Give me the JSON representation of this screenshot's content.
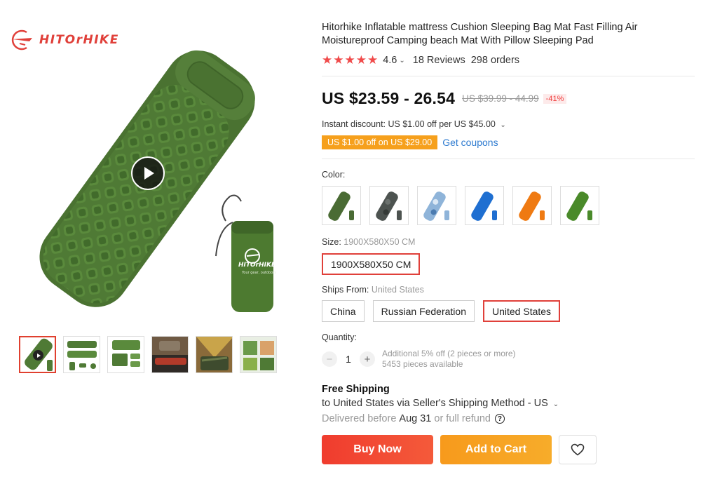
{
  "brand": {
    "name": "HITOrHIKE",
    "color": "#e0403a"
  },
  "gallery": {
    "main_image": "green-inflatable-sleeping-pad-with-pillow-and-stuff-sack",
    "bag_logo": "HITOrHIKE",
    "bag_tagline": "Your gear, outdoors",
    "play_icon": "play-icon",
    "thumbnails": [
      {
        "name": "thumb-video-green-pad",
        "active": true
      },
      {
        "name": "thumb-green-pad-accessories",
        "active": false
      },
      {
        "name": "thumb-green-pad-package",
        "active": false
      },
      {
        "name": "thumb-pad-in-car-trunk",
        "active": false
      },
      {
        "name": "thumb-pad-in-tent",
        "active": false
      },
      {
        "name": "thumb-pad-outdoor-use",
        "active": false
      }
    ]
  },
  "product": {
    "title": "Hitorhike Inflatable mattress Cushion Sleeping Bag Mat Fast Filling Air Moistureproof Camping beach Mat With Pillow Sleeping Pad",
    "rating": "4.6",
    "stars": "★★★★★",
    "reviews": "18 Reviews",
    "orders": "298 orders",
    "price": "US $23.59 - 26.54",
    "original_price": "US $39.99 - 44.99",
    "discount": "-41%",
    "instant_discount": "Instant discount: US $1.00 off per US $45.00",
    "coupon": "US $1.00 off on US $29.00",
    "get_coupons": "Get coupons"
  },
  "color_section": {
    "label": "Color:",
    "swatches": [
      {
        "name": "swatch-army-green",
        "color": "#4a6b34"
      },
      {
        "name": "swatch-camouflage-grey",
        "color": "#4d5350"
      },
      {
        "name": "swatch-sky-camo-blue",
        "color": "#8fb4d9"
      },
      {
        "name": "swatch-blue",
        "color": "#1f6fd1"
      },
      {
        "name": "swatch-orange",
        "color": "#ef7a12"
      },
      {
        "name": "swatch-green",
        "color": "#4a8a2a"
      }
    ]
  },
  "size_section": {
    "label": "Size:",
    "selected_value": "1900X580X50 CM",
    "options": [
      "1900X580X50 CM"
    ]
  },
  "ships_section": {
    "label": "Ships From:",
    "selected_value": "United States",
    "options": [
      "China",
      "Russian Federation",
      "United States"
    ]
  },
  "quantity": {
    "label": "Quantity:",
    "minus": "−",
    "plus": "+",
    "value": "1",
    "note_line1": "Additional 5% off (2 pieces or more)",
    "note_line2": "5453 pieces available"
  },
  "shipping": {
    "title": "Free Shipping",
    "to": "to United States via Seller's Shipping Method - US",
    "delivered_prefix": "Delivered before",
    "delivered_date": "Aug 31",
    "delivered_suffix": "or full refund",
    "help": "?"
  },
  "actions": {
    "buy_now": "Buy Now",
    "add_to_cart": "Add to Cart",
    "buy_color": "#f2462f",
    "cart_color": "#f8a11f"
  }
}
